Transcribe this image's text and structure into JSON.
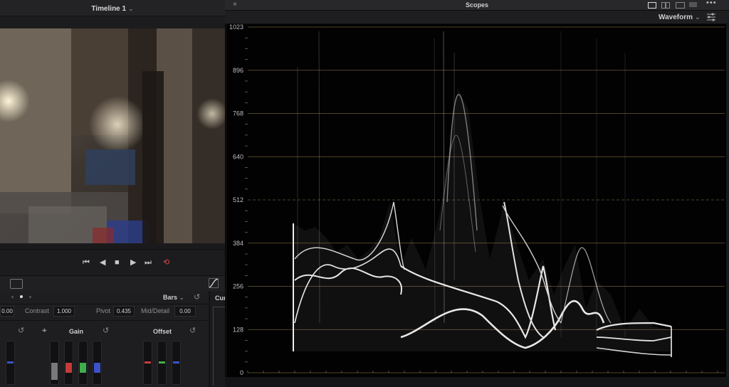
{
  "viewer": {
    "timeline_title": "Timeline 1",
    "pager_dots": 4,
    "active_dot": 2
  },
  "color_panel": {
    "mode_label": "Bars",
    "left_value": "0.00",
    "contrast_label": "Contrast",
    "contrast_value": "1.000",
    "pivot_label": "Pivot",
    "pivot_value": "0.435",
    "mid_detail_label": "Mid/Detail",
    "mid_detail_value": "0.00",
    "gain_label": "Gain",
    "offset_label": "Offset",
    "curves_label": "Cur"
  },
  "scopes": {
    "title": "Scopes",
    "scope_type": "Waveform",
    "y_ticks": [
      "1023",
      "896",
      "768",
      "640",
      "512",
      "384",
      "256",
      "128",
      "0"
    ],
    "grid_color": "#6b5a33",
    "trace_color": "#e8e8e8"
  },
  "colors": {
    "accent_red": "#e04848",
    "gain_red": "#c63a3a",
    "gain_green": "#3fae4c",
    "gain_blue": "#3d52c9"
  }
}
